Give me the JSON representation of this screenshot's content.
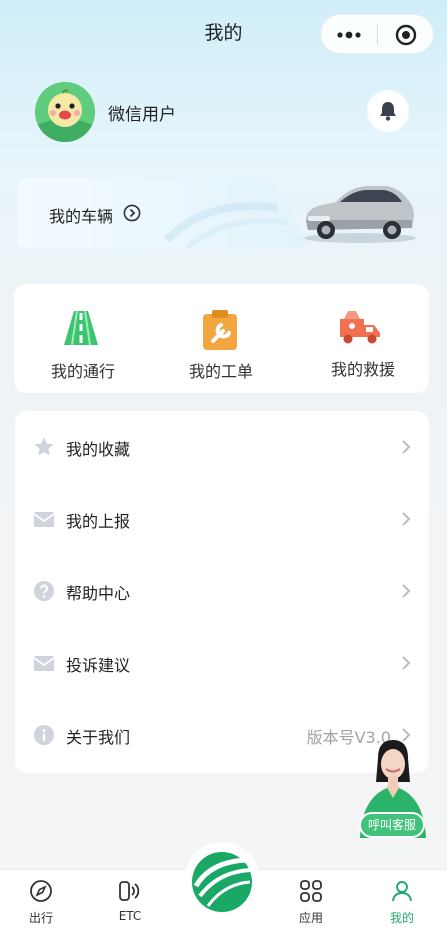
{
  "header": {
    "title": "我的"
  },
  "profile": {
    "username": "微信用户"
  },
  "vehicle": {
    "label": "我的车辆"
  },
  "quick_actions": [
    {
      "label": "我的通行",
      "icon": "road-icon",
      "color": "#3cc56e"
    },
    {
      "label": "我的工单",
      "icon": "clipboard-wrench-icon",
      "color": "#f3a640"
    },
    {
      "label": "我的救援",
      "icon": "tow-truck-icon",
      "color": "#f0704f"
    }
  ],
  "menu": [
    {
      "label": "我的收藏",
      "icon": "star-icon"
    },
    {
      "label": "我的上报",
      "icon": "mail-icon"
    },
    {
      "label": "帮助中心",
      "icon": "question-icon"
    },
    {
      "label": "投诉建议",
      "icon": "mail-icon"
    },
    {
      "label": "关于我们",
      "icon": "info-icon",
      "value": "版本号V3.0"
    }
  ],
  "customer_service": {
    "label": "呼叫客服"
  },
  "tabbar": [
    {
      "label": "出行",
      "icon": "compass-icon"
    },
    {
      "label": "ETC",
      "icon": "etc-icon"
    },
    {
      "label": "应用",
      "icon": "apps-grid-icon"
    },
    {
      "label": "我的",
      "icon": "person-icon",
      "active": true
    }
  ],
  "colors": {
    "accent": "#22a86c",
    "menu_icon": "#cfd3dc"
  }
}
